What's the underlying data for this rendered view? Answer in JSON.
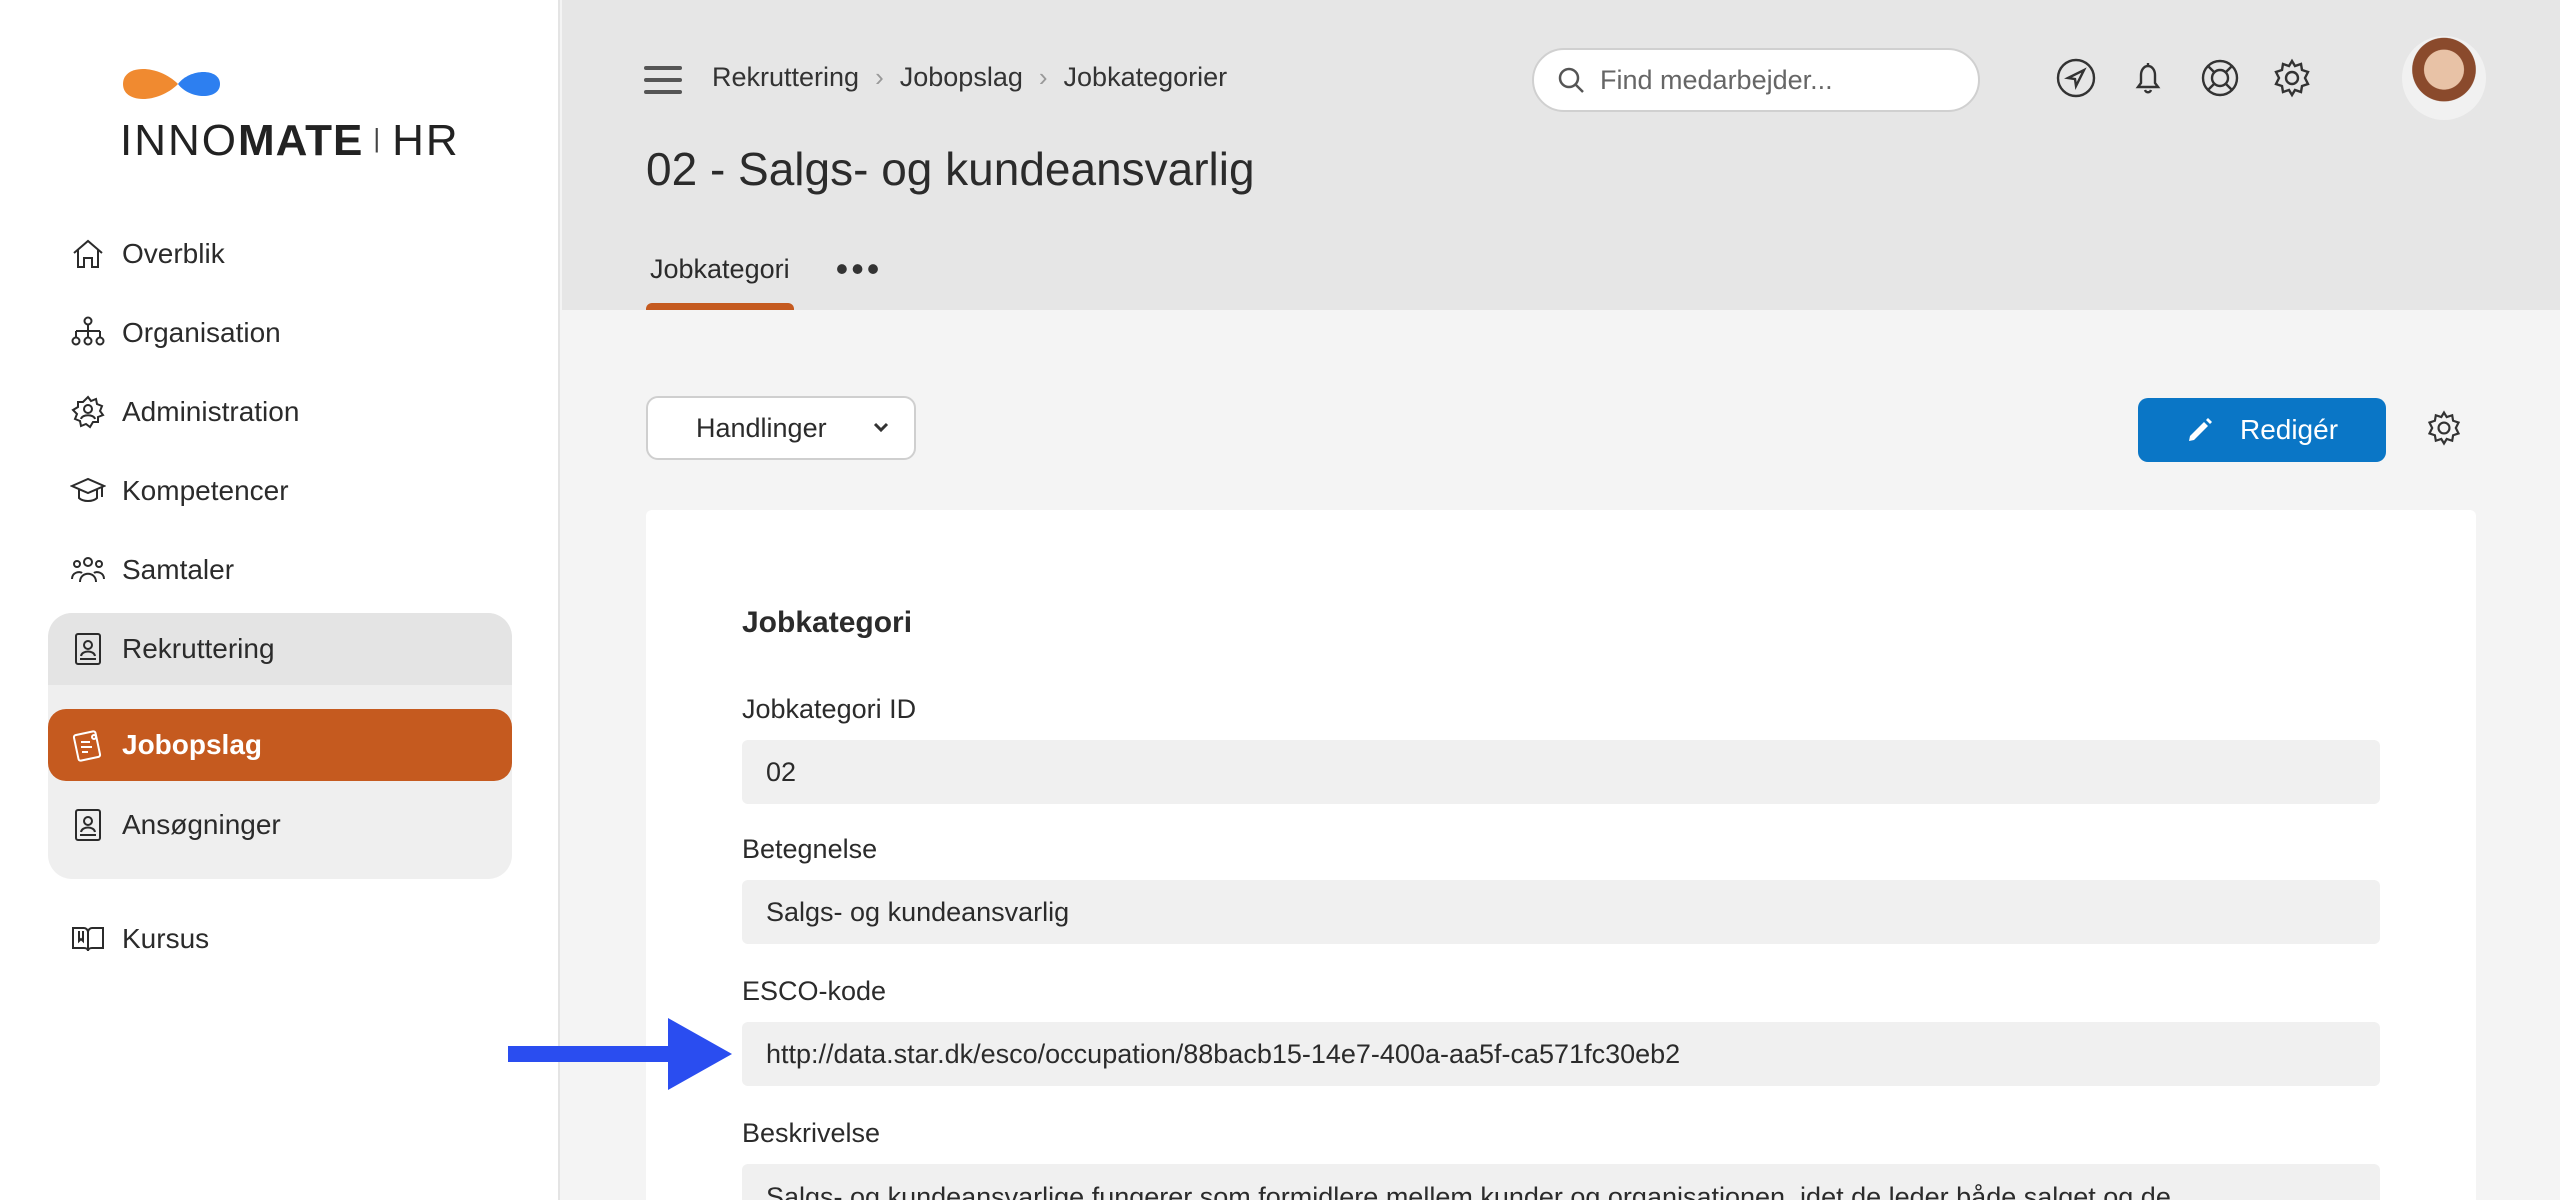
{
  "brand": {
    "name_left": "INNO",
    "name_mid": "MATE",
    "name_right": "HR",
    "colors": {
      "orange": "#f08a30",
      "blue": "#2d7ff0"
    }
  },
  "sidebar": {
    "items": [
      {
        "label": "Overblik",
        "icon": "home-icon"
      },
      {
        "label": "Organisation",
        "icon": "org-chart-icon"
      },
      {
        "label": "Administration",
        "icon": "admin-gear-icon"
      },
      {
        "label": "Kompetencer",
        "icon": "graduation-cap-icon"
      },
      {
        "label": "Samtaler",
        "icon": "people-group-icon"
      }
    ],
    "group": {
      "parent": {
        "label": "Rekruttering",
        "icon": "id-badge-icon"
      },
      "children": [
        {
          "label": "Jobopslag",
          "icon": "job-post-icon",
          "active": true
        },
        {
          "label": "Ansøgninger",
          "icon": "application-icon"
        }
      ]
    },
    "after": [
      {
        "label": "Kursus",
        "icon": "book-icon"
      }
    ]
  },
  "header": {
    "breadcrumb": [
      "Rekruttering",
      "Jobopslag",
      "Jobkategorier"
    ],
    "search_placeholder": "Find medarbejder...",
    "title": "02 - Salgs- og kundeansvarlig",
    "tabs": [
      {
        "label": "Jobkategori",
        "active": true
      }
    ],
    "more": "•••"
  },
  "toolbar": {
    "actions_label": "Handlinger",
    "edit_label": "Redigér"
  },
  "card": {
    "title": "Jobkategori",
    "fields": [
      {
        "label": "Jobkategori ID",
        "value": "02"
      },
      {
        "label": "Betegnelse",
        "value": "Salgs- og kundeansvarlig"
      },
      {
        "label": "ESCO-kode",
        "value": "http://data.star.dk/esco/occupation/88bacb15-14e7-400a-aa5f-ca571fc30eb2"
      },
      {
        "label": "Beskrivelse",
        "value": "Salgs- og kundeansvarlige fungerer som formidlere mellem kunder og organisationen, idet de leder både salget og de"
      }
    ]
  },
  "accent": {
    "active": "#c55a1f",
    "primary": "#0a76c6",
    "arrow": "#2a4df0"
  }
}
